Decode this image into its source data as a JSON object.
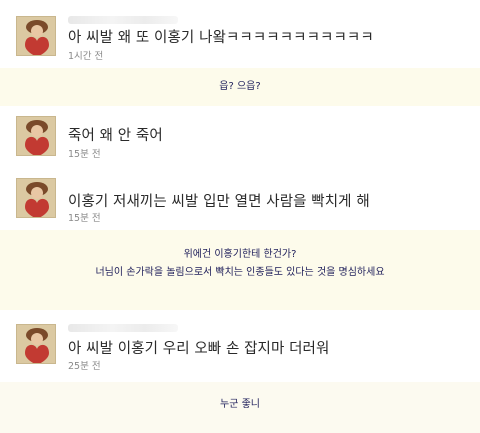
{
  "posts": [
    {
      "message": "아 씨발 왜 또 이홍기 나왘ㅋㅋㅋㅋㅋㅋㅋㅋㅋㅋㅋ",
      "time": "1시간 전"
    },
    {
      "message": "죽어 왜 안 죽어",
      "time": "15분 전"
    },
    {
      "message": "이홍기 저새끼는 씨발 입만 열면 사람을 빡치게 해",
      "time": "15분 전"
    },
    {
      "message": "아 씨발 이홍기 우리 오빠 손 잡지마 더러워",
      "time": "25분 전"
    }
  ],
  "captions": {
    "c1": "읍? 으읍?",
    "c2_line1": "위에건 이홍기한테 한건가?",
    "c2_line2": "너님이 손가락을 놀림으로서 빡치는 인종들도 있다는 것을 명심하세요",
    "c3": "누군 좋니"
  },
  "icons": {
    "avatar": "heart-girl-avatar-icon"
  },
  "colors": {
    "caption_bg": "#fdfbeb",
    "caption_text": "#1e1e5a"
  }
}
